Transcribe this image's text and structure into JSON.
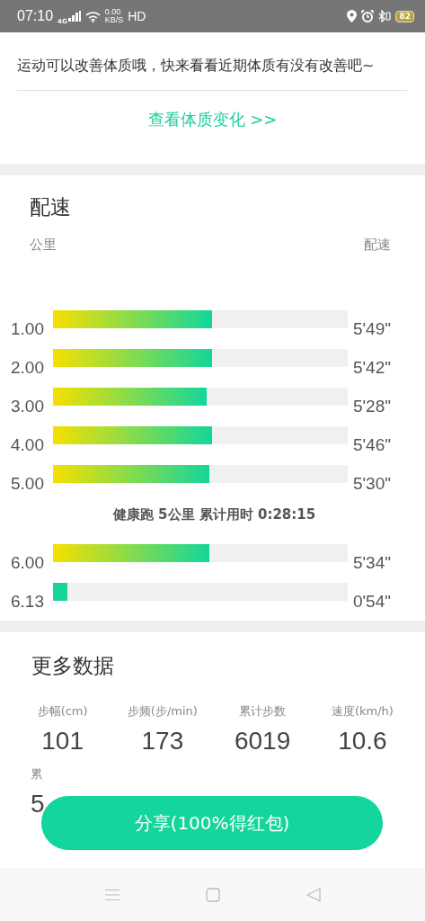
{
  "status_bar": {
    "time": "07:10",
    "network": "4G",
    "speed_value": "0.00",
    "speed_unit": "KB/S",
    "hd": "HD",
    "battery": "82"
  },
  "tip": {
    "text": "运动可以改善体质哦，快来看看近期体质有没有改善吧~",
    "link": "查看体质变化 >>"
  },
  "pace": {
    "title": "配速",
    "left_header": "公里",
    "right_header": "配速",
    "rows": [
      {
        "kind": "bar",
        "km": "1.00",
        "level": 0.54,
        "pace": "5'49\""
      },
      {
        "kind": "bar",
        "km": "2.00",
        "level": 0.54,
        "pace": "5'42\""
      },
      {
        "kind": "bar",
        "km": "3.00",
        "level": 0.52,
        "pace": "5'28\""
      },
      {
        "kind": "bar",
        "km": "4.00",
        "level": 0.54,
        "pace": "5'46\""
      },
      {
        "kind": "bar",
        "km": "5.00",
        "level": 0.53,
        "pace": "5'30\""
      },
      {
        "kind": "summary",
        "text": "健康跑 5公里 累计用时 0:28:15"
      },
      {
        "kind": "bar",
        "km": "6.00",
        "level": 0.53,
        "pace": "5'34\""
      },
      {
        "kind": "bar",
        "km": "6.13",
        "level": 0.05,
        "pace": "0'54\""
      }
    ]
  },
  "more": {
    "title": "更多数据",
    "stats": [
      {
        "label": "步幅(cm)",
        "value": "101"
      },
      {
        "label": "步频(步/min)",
        "value": "173"
      },
      {
        "label": "累计步数",
        "value": "6019"
      },
      {
        "label": "速度(km/h)",
        "value": "10.6"
      },
      {
        "label": "累",
        "value": "5"
      }
    ]
  },
  "share_button": "分享(100%得红包)"
}
